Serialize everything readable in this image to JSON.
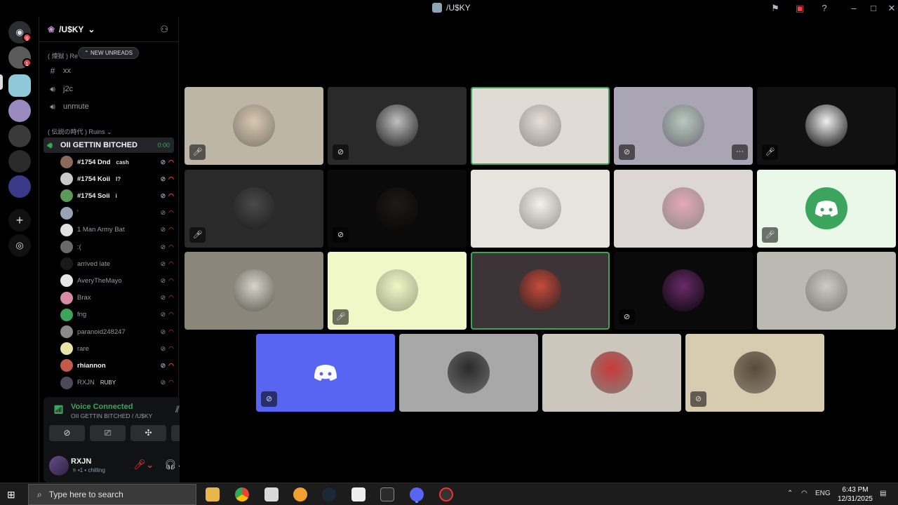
{
  "window": {
    "title": "/U$KY"
  },
  "guild": {
    "name": "/U$KY"
  },
  "categories": {
    "first": "( 煉獄 ) Re",
    "second": "( 伝説の時代 ) Ruins"
  },
  "new_unreads": "NEW UNREADS",
  "channels": [
    {
      "label": "xx",
      "type": "text"
    },
    {
      "label": "j2c",
      "type": "voice"
    },
    {
      "label": "unmute",
      "type": "voice"
    }
  ],
  "active_voice_channel": {
    "label": "OII GETTIN BITCHED",
    "timer": "0:00"
  },
  "voice_users": [
    {
      "name": "#1754 Dnd",
      "tag": "cash",
      "color": "#8a6a58"
    },
    {
      "name": "#1754 Koii",
      "tag": "I?",
      "color": "#c9c9c9"
    },
    {
      "name": "#1754 Soii",
      "tag": "i",
      "color": "#5c9a5a"
    },
    {
      "name": "'",
      "tag": "",
      "color": "#9aa3b5"
    },
    {
      "name": "1 Man Army Bat",
      "tag": "",
      "color": "#e0e0e0"
    },
    {
      "name": ":(",
      "tag": "",
      "color": "#6a6a6a"
    },
    {
      "name": "arrived late",
      "tag": "",
      "color": "#1a1a1a"
    },
    {
      "name": "AveryTheMayo",
      "tag": "",
      "color": "#e8e6e0"
    },
    {
      "name": "Brax",
      "tag": "",
      "color": "#d98aa8"
    },
    {
      "name": "fng",
      "tag": "",
      "color": "#3ba55d"
    },
    {
      "name": "paranoid248247",
      "tag": "",
      "color": "#8a8a8a"
    },
    {
      "name": "rare",
      "tag": "",
      "color": "#e8e4a8"
    },
    {
      "name": "rhiannon",
      "tag": "",
      "color": "#c45a4a"
    },
    {
      "name": "RXJN",
      "tag": "RUBY",
      "color": "#4a4a5a"
    }
  ],
  "voice_status": {
    "title": "Voice Connected",
    "subtitle": "OII GETTIN BITCHED / /U$KY"
  },
  "user": {
    "name": "RXJN",
    "status": "chilling"
  },
  "search": {
    "placeholder": "Type here to search"
  },
  "tray": {
    "lang": "ENG",
    "time": "6:43 PM",
    "date": "12/31/2025"
  },
  "tiles": [
    {
      "bg": "#bdb5a6",
      "pfp": "#d9c9b0",
      "muted": true
    },
    {
      "bg": "#2a2a2a",
      "pfp": "#c0c0c0",
      "muted": true,
      "deafened": true
    },
    {
      "bg": "#e0dbd5",
      "pfp": "#e8e0d8",
      "speaking": true
    },
    {
      "bg": "#a9a5b2",
      "pfp": "#b8c9c0",
      "muted": true,
      "deafened": true,
      "more": true
    },
    {
      "bg": "#111111",
      "pfp": "#f0f0f0",
      "muted": true
    },
    {
      "bg": "#2a2a2a",
      "pfp": "#4a4a4a",
      "muted": true
    },
    {
      "bg": "#0a0a0a",
      "pfp": "#1e1a18",
      "muted": true,
      "deafened": true
    },
    {
      "bg": "#e6e4dc",
      "pfp": "#f4f2ea"
    },
    {
      "bg": "#dcd6d4",
      "pfp": "#e6a8b8"
    },
    {
      "bg": "#eaf8ea",
      "discord": "#3ba55d",
      "muted": true
    },
    {
      "bg": "#8a867a",
      "pfp": "#d8d4cc"
    },
    {
      "bg": "#f0f8c8",
      "pfp": "#f0f8c8",
      "muted": true
    },
    {
      "bg": "#3c3437",
      "pfp": "#c84a3a",
      "speaking": true
    },
    {
      "bg": "#0a0a0a",
      "pfp": "#6a2a6a",
      "muted": true,
      "deafened": true
    },
    {
      "bg": "#bcb8b2",
      "pfp": "#cfcbc4"
    },
    {
      "bg": "#5865f2",
      "discord": "#5865f2",
      "muted": true,
      "deafened": true
    },
    {
      "bg": "#a8a8a8",
      "pfp": "#2a2a2a"
    },
    {
      "bg": "#cdc6bd",
      "pfp": "#c83a3a"
    },
    {
      "bg": "#d8ccb0",
      "pfp": "#5a4a3a",
      "muted": true,
      "deafened": true
    }
  ]
}
